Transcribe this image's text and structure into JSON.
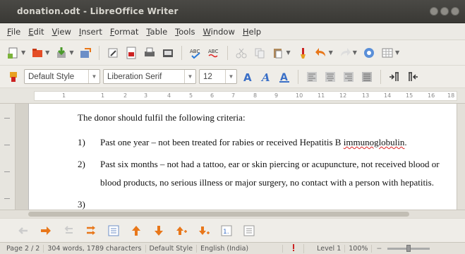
{
  "window": {
    "title": "donation.odt - LibreOffice Writer"
  },
  "menu": [
    "File",
    "Edit",
    "View",
    "Insert",
    "Format",
    "Table",
    "Tools",
    "Window",
    "Help"
  ],
  "formatting": {
    "paragraph_style": "Default Style",
    "font_name": "Liberation Serif",
    "font_size": "12"
  },
  "ruler": {
    "labels": [
      "1",
      "1",
      "2",
      "3",
      "4",
      "5",
      "6",
      "7",
      "8",
      "9",
      "10",
      "11",
      "12",
      "13",
      "14",
      "15",
      "16",
      "18"
    ]
  },
  "document": {
    "heading_line": "The donor should fulfil the following criteria:",
    "items": [
      {
        "number": "1)",
        "text_before": "Past one year – not been treated for rabies or received Hepatitis B ",
        "misspelled": "immunoglobulin",
        "text_after": "."
      },
      {
        "number": "2)",
        "line1": "Past six months – not had a tattoo, ear or skin piercing or acupuncture, not received blood or",
        "line2": "blood products, no serious illness or major surgery, no contact with a person with hepatitis."
      },
      {
        "number": "3)"
      }
    ]
  },
  "status": {
    "page": "Page 2 / 2",
    "words": "304 words, 1789 characters",
    "style": "Default Style",
    "language": "English (India)",
    "level": "Level 1",
    "zoom": "100%"
  },
  "colors": {
    "titlebar": "#3c3b37",
    "toolbar": "#efede8",
    "accent_orange": "#e8771a"
  }
}
